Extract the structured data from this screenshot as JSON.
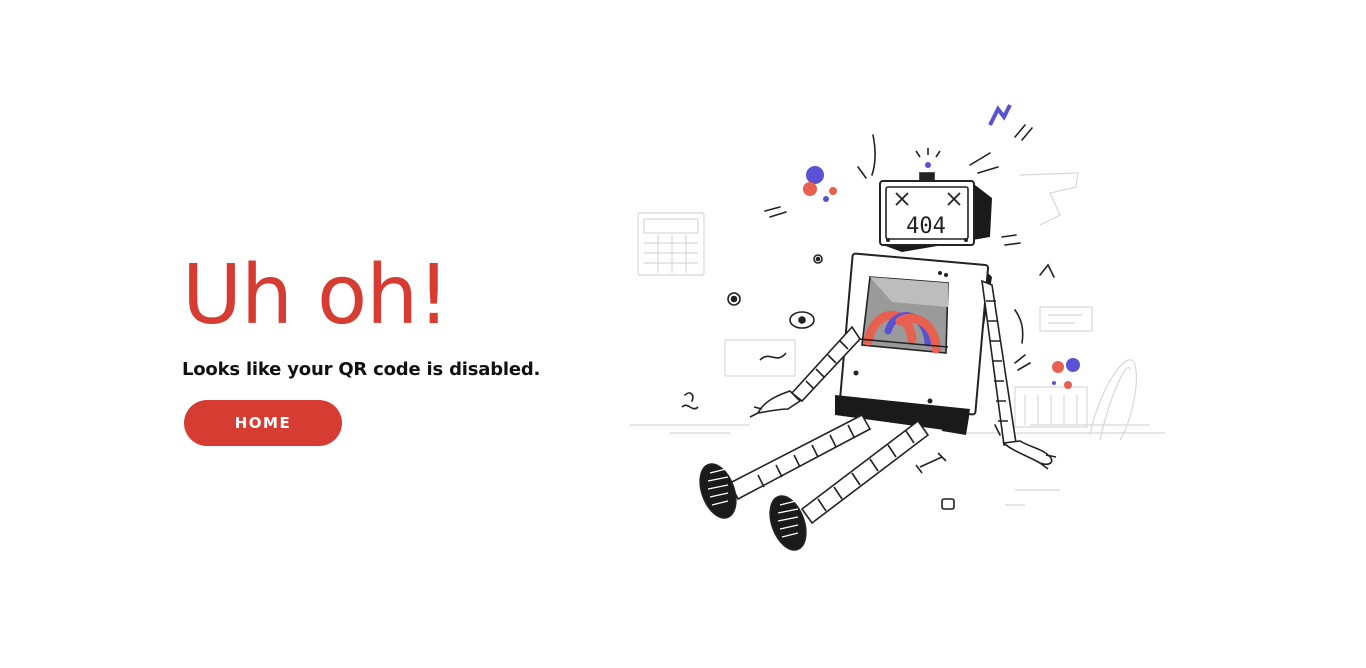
{
  "main": {
    "headline": "Uh oh!",
    "message": "Looks like your QR code is disabled.",
    "home_button_label": "HOME"
  },
  "illustration": {
    "screen_text": "404",
    "accent_color": "#d63c32",
    "secondary_color": "#5a52d5"
  },
  "colors": {
    "brand": "#d63c32",
    "text": "#111111",
    "background": "#ffffff"
  }
}
